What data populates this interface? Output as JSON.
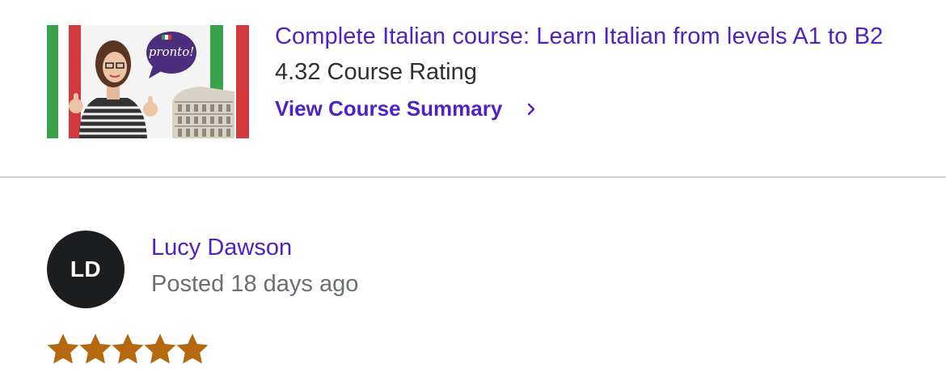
{
  "course": {
    "thumbnail_text": "pronto!",
    "title": "Complete Italian course: Learn Italian from levels A1 to B2",
    "rating_text": "4.32 Course Rating",
    "summary_link": "View Course Summary"
  },
  "review": {
    "avatar_initials": "LD",
    "reviewer_name": "Lucy Dawson",
    "posted": "Posted 18 days ago",
    "stars": 5,
    "star_max": 5
  },
  "colors": {
    "accent": "#5022c3",
    "star": "#b4690e",
    "muted": "#6a6f73",
    "divider": "#d1d2e0"
  },
  "icons": [
    "chevron-right-icon",
    "star-icon"
  ]
}
